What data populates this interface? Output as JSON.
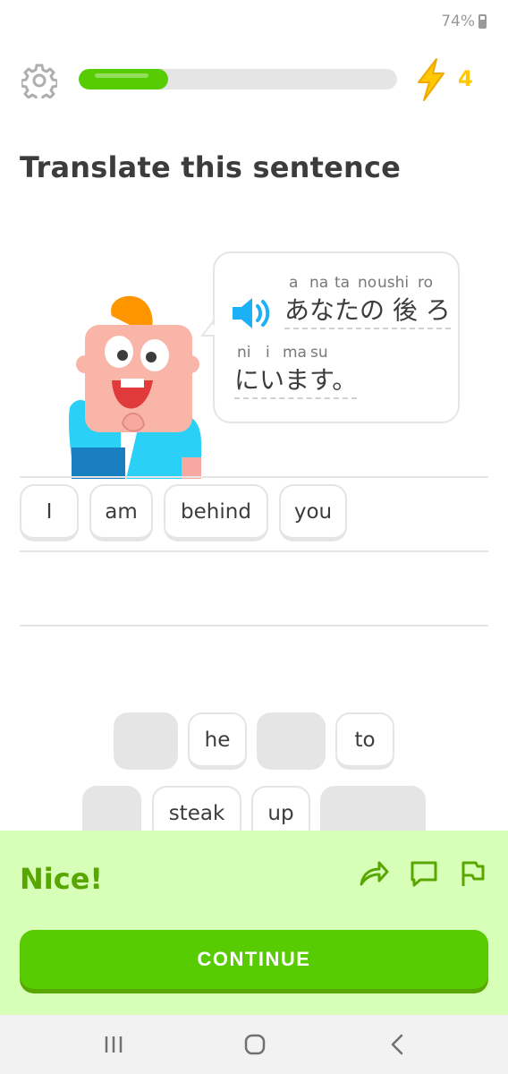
{
  "status": {
    "battery_text": "74%"
  },
  "header": {
    "progress_fraction": 0.28,
    "energy_count": "4"
  },
  "prompt": {
    "title": "Translate this sentence"
  },
  "sentence": {
    "line1_hints": [
      "a",
      "na",
      "ta",
      "no",
      "ushi",
      "ro"
    ],
    "line1_jp": "あなたの 後 ろ",
    "line2_hints": [
      "ni",
      "i",
      "ma",
      "su"
    ],
    "line2_jp": "にいます。"
  },
  "answer_words": [
    "I",
    "am",
    "behind",
    "you"
  ],
  "word_bank": [
    "he",
    "to",
    "steak",
    "up"
  ],
  "feedback": {
    "message": "Nice!",
    "continue_label": "CONTINUE",
    "icons": [
      "share-icon",
      "comment-icon",
      "flag-icon"
    ]
  },
  "colors": {
    "green": "#58cc02",
    "dark_green": "#58a700",
    "feedback_bg": "#d7ffb8",
    "gold": "#ffc800",
    "blue": "#1cb0f6"
  }
}
